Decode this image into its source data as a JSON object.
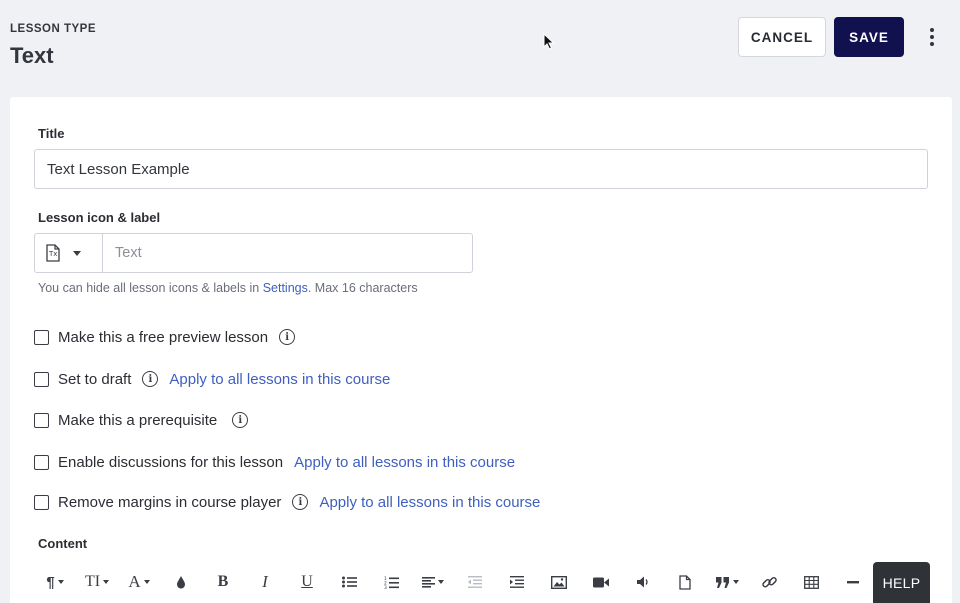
{
  "header": {
    "lesson_type_label": "LESSON TYPE",
    "lesson_type_value": "Text",
    "cancel_label": "CANCEL",
    "save_label": "SAVE"
  },
  "form": {
    "title_label": "Title",
    "title_value": "Text Lesson Example",
    "icon_label": "Lesson icon & label",
    "icon_name": "text-document-icon",
    "label_placeholder": "Text",
    "hint_prefix": "You can hide all lesson icons & labels in ",
    "hint_link": "Settings",
    "hint_suffix": ". Max 16 characters",
    "options": [
      {
        "label": "Make this a free preview lesson",
        "checked": false,
        "info": true,
        "apply": ""
      },
      {
        "label": "Set to draft",
        "checked": false,
        "info": true,
        "apply": "Apply to all lessons in this course"
      },
      {
        "label": "Make this a prerequisite",
        "checked": false,
        "info": true,
        "apply": ""
      },
      {
        "label": "Enable discussions for this lesson",
        "checked": false,
        "info": false,
        "apply": "Apply to all lessons in this course"
      },
      {
        "label": "Remove margins in course player",
        "checked": false,
        "info": true,
        "apply": "Apply to all lessons in this course"
      }
    ],
    "content_label": "Content"
  },
  "toolbar": {
    "paragraph": "¶",
    "text_size": "TI",
    "font": "A",
    "bold": "B",
    "italic": "I",
    "underline": "U"
  },
  "help_label": "HELP",
  "colors": {
    "accent": "#12114f",
    "link": "#3f5fbf",
    "background": "#f0f1f4"
  }
}
